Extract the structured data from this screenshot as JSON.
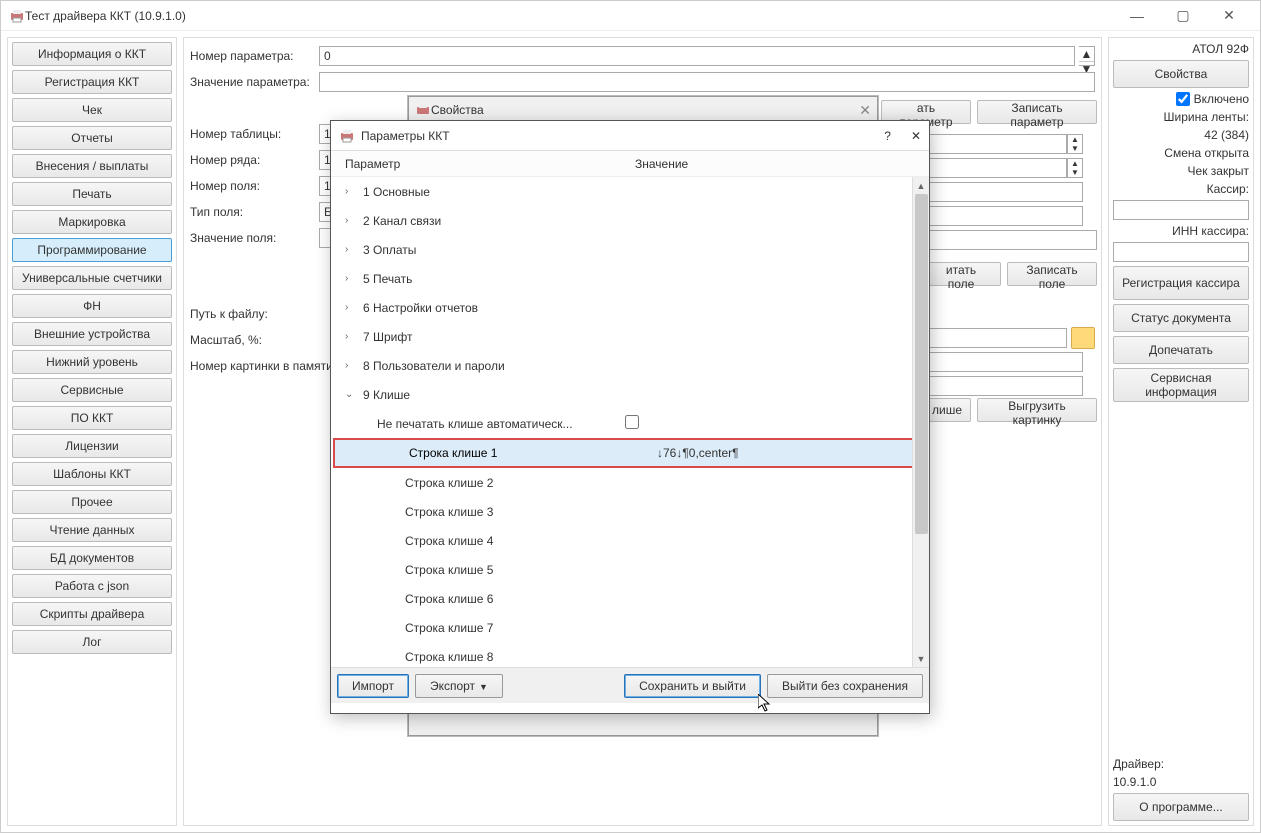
{
  "window": {
    "title": "Тест драйвера ККТ (10.9.1.0)",
    "min": "—",
    "max": "▢",
    "close": "✕"
  },
  "sidebar": {
    "items": [
      "Информация о ККТ",
      "Регистрация ККТ",
      "Чек",
      "Отчеты",
      "Внесения / выплаты",
      "Печать",
      "Маркировка",
      "Программирование",
      "Универсальные счетчики",
      "ФН",
      "Внешние устройства",
      "Нижний уровень",
      "Сервисные",
      "ПО ККТ",
      "Лицензии",
      "Шаблоны ККТ",
      "Прочее",
      "Чтение данных",
      "БД документов",
      "Работа с json",
      "Скрипты драйвера",
      "Лог"
    ],
    "active_index": 7
  },
  "center": {
    "param_num_label": "Номер параметра:",
    "param_num": "0",
    "param_val_label": "Значение параметра:",
    "table_num_label": "Номер таблицы:",
    "table_num": "1",
    "row_num_label": "Номер ряда:",
    "row_num": "1",
    "field_num_label": "Номер поля:",
    "field_num": "1",
    "field_type_label": "Тип поля:",
    "field_type": "Байты",
    "field_val_label": "Значение поля:",
    "path_label": "Путь к файлу:",
    "scale_label": "Масштаб, %:",
    "pic_num_label": "Номер картинки в памяти",
    "read_param_btn": "ать параметр",
    "write_param_btn": "Записать параметр",
    "read_field_btn": "итать поле",
    "write_field_btn": "Записать поле",
    "load_cliche_btn": "лише",
    "unload_pic_btn": "Выгрузить картинку"
  },
  "right": {
    "device": "АТОЛ 92Ф",
    "properties_btn": "Свойства",
    "enabled_chk": "Включено",
    "tape_label": "Ширина ленты:",
    "tape_val": "42 (384)",
    "shift_open": "Смена открыта",
    "check_closed": "Чек закрыт",
    "cashier_label": "Кассир:",
    "cashier_inn_label": "ИНН кассира:",
    "reg_cashier_btn": "Регистрация кассира",
    "doc_status_btn": "Статус документа",
    "reprint_btn": "Допечатать",
    "service_info_btn": "Сервисная информация",
    "driver_label": "Драйвер:",
    "driver_ver": "10.9.1.0",
    "about_btn": "О программе..."
  },
  "props_dialog": {
    "title": "Свойства"
  },
  "param_dialog": {
    "title": "Параметры ККТ",
    "help": "?",
    "close": "✕",
    "col_param": "Параметр",
    "col_value": "Значение",
    "groups": [
      "1 Основные",
      "2 Канал связи",
      "3 Оплаты",
      "5 Печать",
      "6 Настройки отчетов",
      "7 Шрифт",
      "8 Пользователи и пароли",
      "9 Клише"
    ],
    "auto_cliche": "Не печатать клише автоматическ...",
    "cliche_rows": [
      {
        "label": "Строка клише 1",
        "value": "↓76↓¶0,center¶"
      },
      {
        "label": "Строка клише 2",
        "value": ""
      },
      {
        "label": "Строка клише 3",
        "value": ""
      },
      {
        "label": "Строка клише 4",
        "value": ""
      },
      {
        "label": "Строка клише 5",
        "value": ""
      },
      {
        "label": "Строка клише 6",
        "value": ""
      },
      {
        "label": "Строка клише 7",
        "value": ""
      },
      {
        "label": "Строка клише 8",
        "value": ""
      }
    ],
    "import_btn": "Импорт",
    "export_btn": "Экспорт",
    "save_exit_btn": "Сохранить и выйти",
    "exit_nosave_btn": "Выйти без сохранения"
  }
}
